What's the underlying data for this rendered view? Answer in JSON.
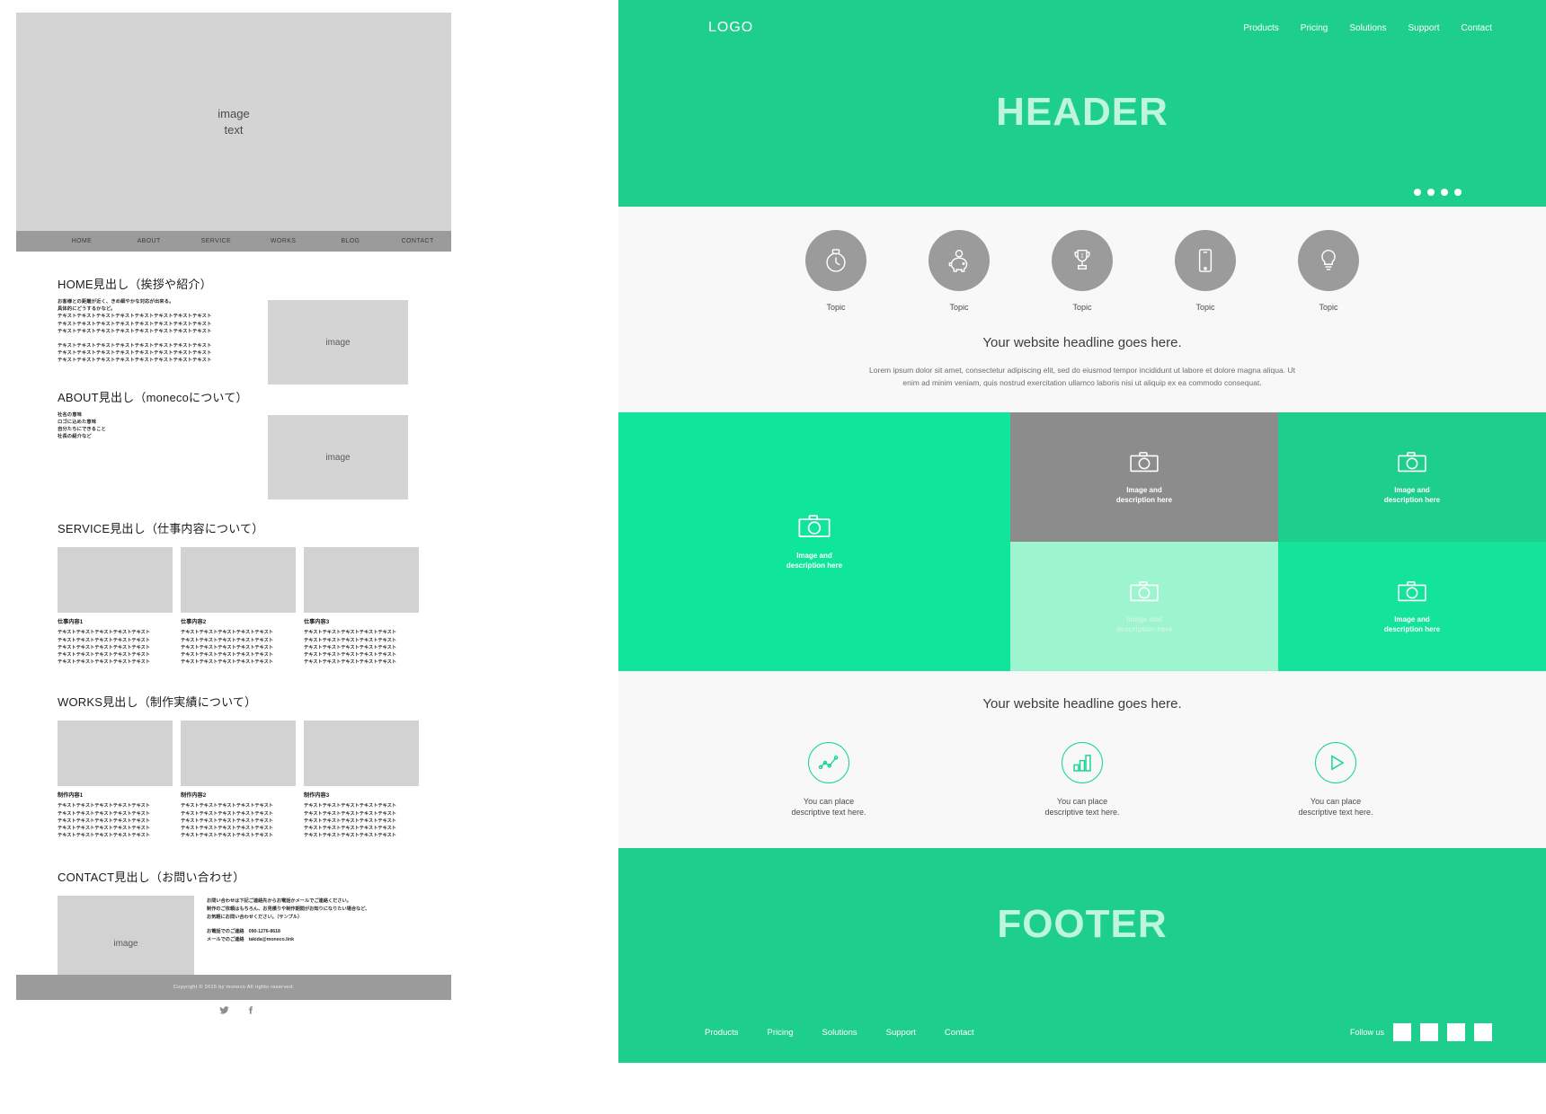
{
  "left_mockup": {
    "hero": {
      "line1": "image",
      "line2": "text"
    },
    "nav": [
      {
        "label": "HOME"
      },
      {
        "label": "ABOUT"
      },
      {
        "label": "SERVICE"
      },
      {
        "label": "WORKS"
      },
      {
        "label": "BLOG"
      },
      {
        "label": "CONTACT"
      }
    ],
    "home": {
      "heading": "HOME見出し（挨拶や紹介）",
      "lead1": "お客様との距離が近く、きめ細やかな対応が出来る。",
      "lead2": "具体的にどうするかなど。",
      "body1": "テキストテキストテキストテキストテキストテキストテキストテキスト\nテキストテキストテキストテキストテキストテキストテキストテキスト\nテキストテキストテキストテキストテキストテキストテキストテキスト",
      "body2": "テキストテキストテキストテキストテキストテキストテキストテキスト\nテキストテキストテキストテキストテキストテキストテキストテキスト\nテキストテキストテキストテキストテキストテキストテキストテキスト",
      "image_label": "image"
    },
    "about": {
      "heading": "ABOUT見出し（monecoについて）",
      "body": "社名の意味\nロゴに込めた意味\n自分たちにできること\n社長の紹介など",
      "image_label": "image"
    },
    "service": {
      "heading": "SERVICE見出し（仕事内容について）",
      "cards": [
        {
          "title": "仕事内容1",
          "text": "テキストテキストテキストテキストテキスト\nテキストテキストテキストテキストテキスト\nテキストテキストテキストテキストテキスト\nテキストテキストテキストテキストテキスト\nテキストテキストテキストテキストテキスト"
        },
        {
          "title": "仕事内容2",
          "text": "テキストテキストテキストテキストテキスト\nテキストテキストテキストテキストテキスト\nテキストテキストテキストテキストテキスト\nテキストテキストテキストテキストテキスト\nテキストテキストテキストテキストテキスト"
        },
        {
          "title": "仕事内容3",
          "text": "テキストテキストテキストテキストテキスト\nテキストテキストテキストテキストテキスト\nテキストテキストテキストテキストテキスト\nテキストテキストテキストテキストテキスト\nテキストテキストテキストテキストテキスト"
        }
      ]
    },
    "works": {
      "heading": "WORKS見出し（制作実績について）",
      "cards": [
        {
          "title": "制作内容1",
          "text": "テキストテキストテキストテキストテキスト\nテキストテキストテキストテキストテキスト\nテキストテキストテキストテキストテキスト\nテキストテキストテキストテキストテキスト\nテキストテキストテキストテキストテキスト"
        },
        {
          "title": "制作内容2",
          "text": "テキストテキストテキストテキストテキスト\nテキストテキストテキストテキストテキスト\nテキストテキストテキストテキストテキスト\nテキストテキストテキストテキストテキスト\nテキストテキストテキストテキストテキスト"
        },
        {
          "title": "制作内容3",
          "text": "テキストテキストテキストテキストテキスト\nテキストテキストテキストテキストテキスト\nテキストテキストテキストテキストテキスト\nテキストテキストテキストテキストテキスト\nテキストテキストテキストテキストテキスト"
        }
      ]
    },
    "contact": {
      "heading": "CONTACT見出し（お問い合わせ）",
      "image_label": "image",
      "lines": "お問い合わせは下記ご連絡先からお電話かメールでご連絡ください。\n制作のご依頼はもちろん、お見積りや制作期間がお知りになりたい場合など、\nお気軽にお問い合わせください。（サンプル）",
      "phone": "お電話でのご連絡　090-1276-8618",
      "email": "メールでのご連絡　takida@moneco.link",
      "social": [
        {
          "name": "twitter-icon"
        },
        {
          "name": "facebook-icon"
        }
      ]
    },
    "footer": {
      "copyright": "Copyright © 2015 by moneco All rights reserved."
    }
  },
  "right_mockup": {
    "header": {
      "logo": "LOGO",
      "nav": [
        {
          "label": "Products"
        },
        {
          "label": "Pricing"
        },
        {
          "label": "Solutions"
        },
        {
          "label": "Support"
        },
        {
          "label": "Contact"
        }
      ],
      "title": "HEADER",
      "dot_count": 4
    },
    "topics": [
      {
        "icon": "stopwatch-icon",
        "label": "Topic"
      },
      {
        "icon": "piggy-bank-icon",
        "label": "Topic"
      },
      {
        "icon": "trophy-icon",
        "label": "Topic"
      },
      {
        "icon": "mobile-phone-icon",
        "label": "Topic"
      },
      {
        "icon": "lightbulb-icon",
        "label": "Topic"
      }
    ],
    "headline_section": {
      "headline": "Your website headline goes here.",
      "paragraph": "Lorem ipsum dolor sit amet, consectetur adipiscing elit, sed do eiusmod tempor incididunt ut labore et dolore magna aliqua. Ut enim ad minim veniam, quis nostrud exercitation ullamco laboris nisi ut aliquip ex ea commodo consequat."
    },
    "gallery": {
      "big": {
        "icon": "camera-icon",
        "caption": "Image and\ndescription here",
        "color": "#0fe59b"
      },
      "cells": [
        {
          "icon": "camera-icon",
          "caption": "Image and\ndescription here",
          "color": "#8c8c8c"
        },
        {
          "icon": "camera-icon",
          "caption": "Image and\ndescription here",
          "color": "#1ece8c"
        },
        {
          "icon": "camera-icon",
          "caption": "Image and\ndescription here",
          "color": "#9cf5ce"
        },
        {
          "icon": "camera-icon",
          "caption": "Image and\ndescription here",
          "color": "#13e39b"
        }
      ]
    },
    "features_section": {
      "headline": "Your website headline goes here.",
      "features": [
        {
          "icon": "line-chart-icon",
          "text": "You can place\ndescriptive text here."
        },
        {
          "icon": "bar-chart-icon",
          "text": "You can place\ndescriptive text here."
        },
        {
          "icon": "play-button-icon",
          "text": "You can place\ndescriptive text here."
        }
      ]
    },
    "footer": {
      "title": "FOOTER",
      "nav": [
        {
          "label": "Products"
        },
        {
          "label": "Pricing"
        },
        {
          "label": "Solutions"
        },
        {
          "label": "Support"
        },
        {
          "label": "Contact"
        }
      ],
      "follow_label": "Follow us",
      "social_count": 4
    }
  },
  "colors": {
    "brand_green": "#1ece8c",
    "bright_green": "#0fe59b",
    "pale_green": "#9cf5ce",
    "header_text_green": "#bdf5de",
    "gray": "#9b9b9b",
    "light_gray": "#d4d4d4",
    "panel_bg": "#f8f8f8"
  }
}
